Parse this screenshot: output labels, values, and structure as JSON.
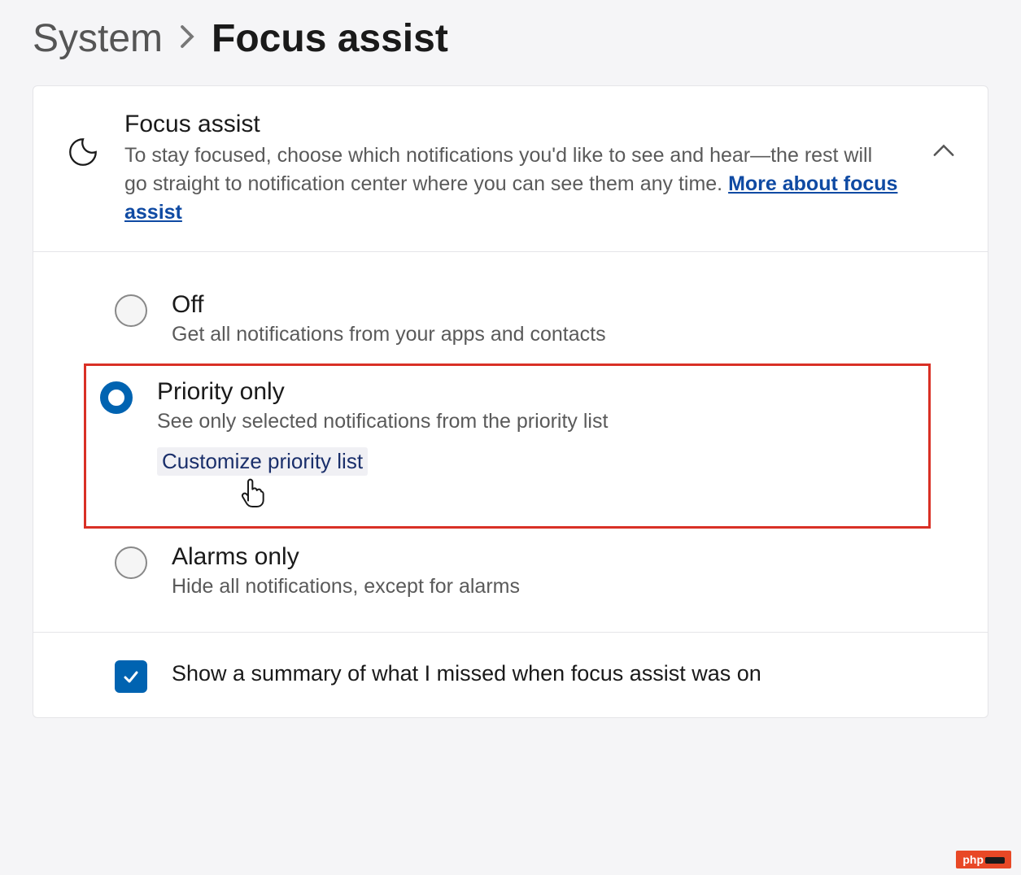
{
  "breadcrumb": {
    "parent": "System",
    "current": "Focus assist"
  },
  "header": {
    "title": "Focus assist",
    "description_prefix": "To stay focused, choose which notifications you'd like to see and hear—the rest will go straight to notification center where you can see them any time.  ",
    "link": "More about focus assist"
  },
  "options": {
    "off": {
      "title": "Off",
      "desc": "Get all notifications from your apps and contacts",
      "selected": false
    },
    "priority": {
      "title": "Priority only",
      "desc": "See only selected notifications from the priority list",
      "sublink": "Customize priority list",
      "selected": true
    },
    "alarms": {
      "title": "Alarms only",
      "desc": "Hide all notifications, except for alarms",
      "selected": false
    }
  },
  "checkbox": {
    "label": "Show a summary of what I missed when focus assist was on",
    "checked": true
  },
  "watermark": "php"
}
